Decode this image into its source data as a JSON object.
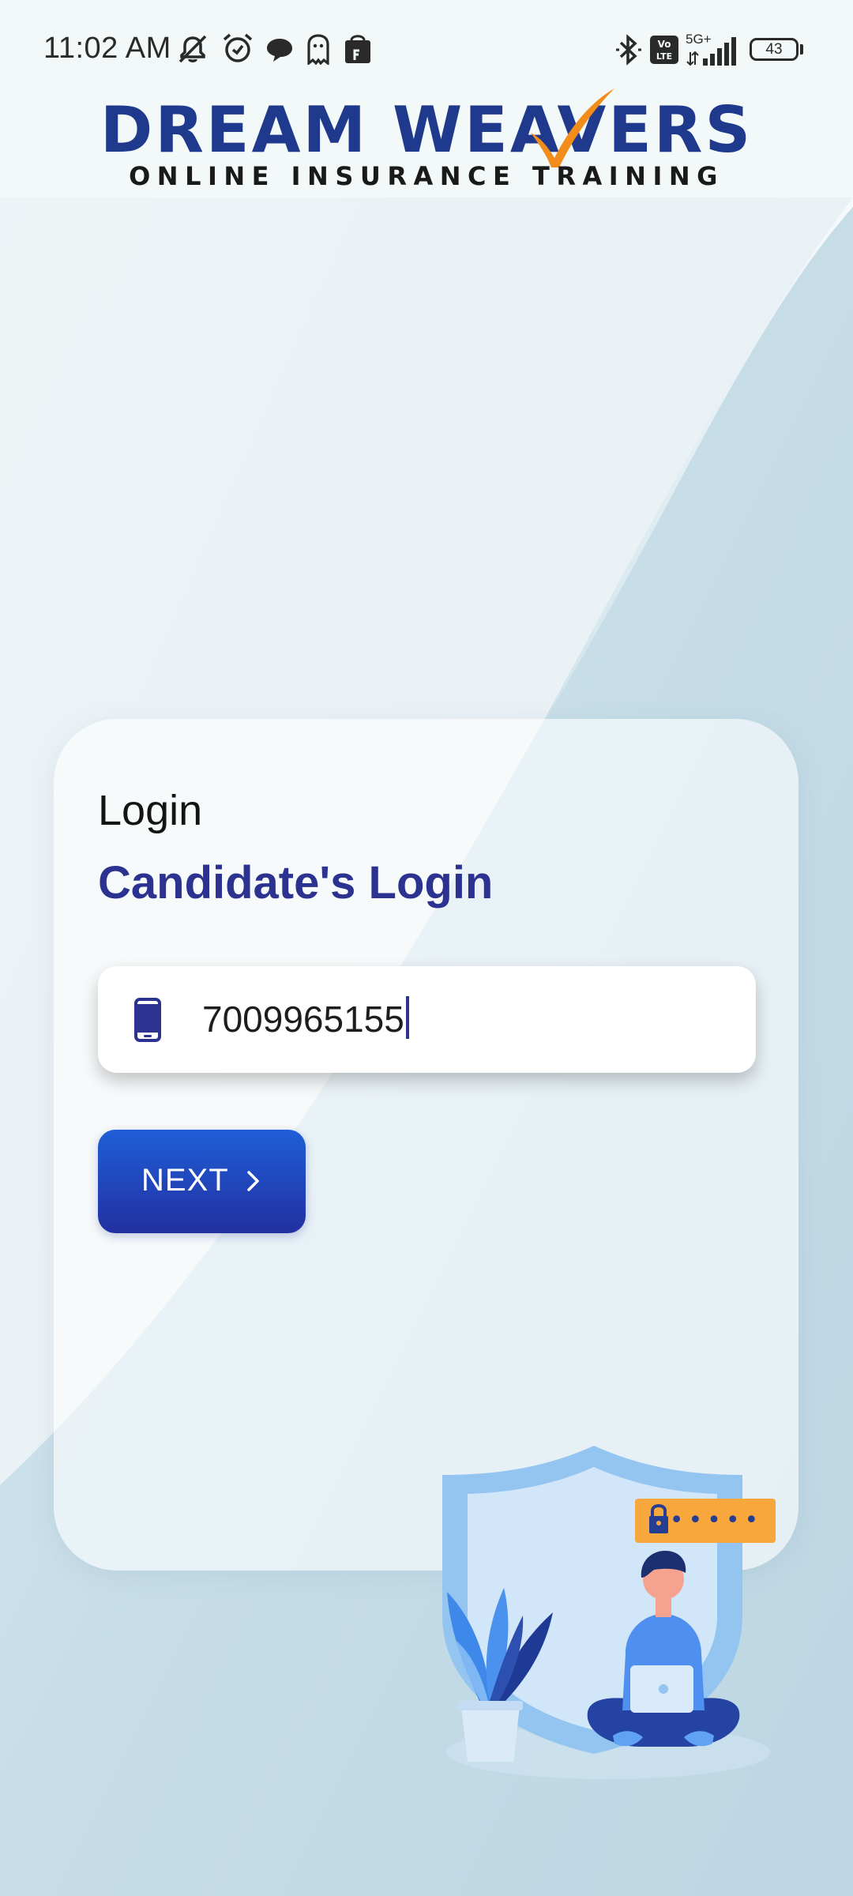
{
  "status_bar": {
    "time": "11:02 AM",
    "network_label": "5G+",
    "volte_label": "Vo LTE",
    "battery_level": "43"
  },
  "header": {
    "logo_title": "DREAM WEAVERS",
    "logo_subtitle": "ONLINE INSURANCE TRAINING"
  },
  "login": {
    "heading": "Login",
    "title": "Candidate's Login",
    "phone_value": "7009965155",
    "next_label": "NEXT"
  },
  "illustration": {
    "password_mask": "•••••"
  },
  "colors": {
    "brand_blue": "#2b3290",
    "button_top": "#1f5ed8",
    "button_bottom": "#2230a0",
    "logo_check": "#f28c1a"
  },
  "icons": {
    "phone": "smartphone-icon",
    "next": "chevron-right-icon",
    "status": [
      "mute-icon",
      "alarm-icon",
      "chat-icon",
      "ghost-icon",
      "bag-icon",
      "bluetooth-icon",
      "volte-icon",
      "signal-icon",
      "battery-icon"
    ]
  }
}
